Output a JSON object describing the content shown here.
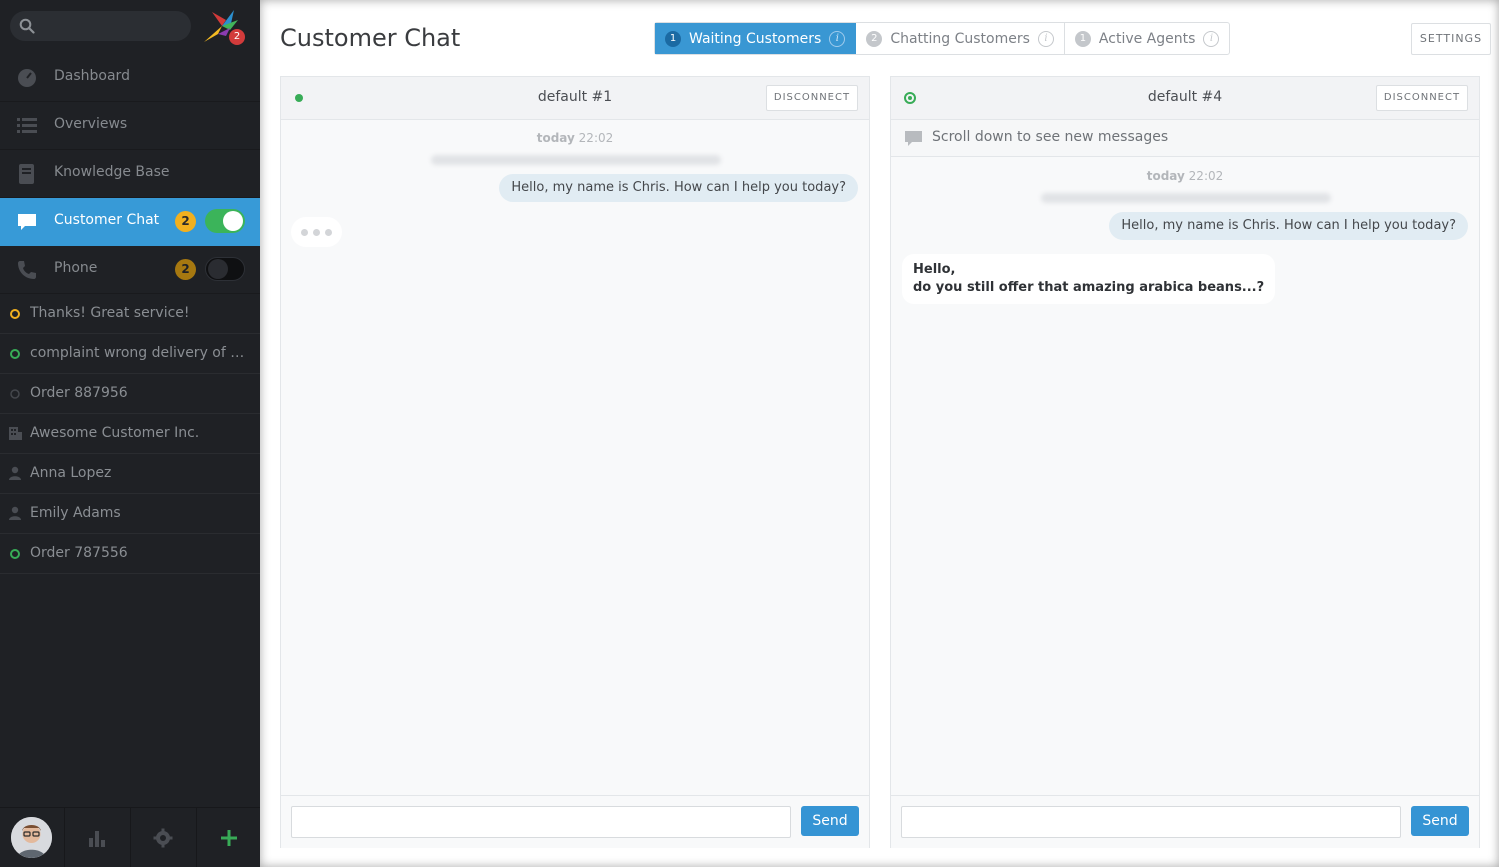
{
  "logo": {
    "badge": "2"
  },
  "nav": [
    {
      "label": "Dashboard"
    },
    {
      "label": "Overviews"
    },
    {
      "label": "Knowledge Base"
    },
    {
      "label": "Customer Chat",
      "count": "2"
    },
    {
      "label": "Phone",
      "count": "2"
    }
  ],
  "tasks": [
    {
      "label": "Thanks! Great service!"
    },
    {
      "label": "complaint wrong delivery of order"
    },
    {
      "label": "Order 887956"
    },
    {
      "label": "Awesome Customer Inc."
    },
    {
      "label": "Anna Lopez"
    },
    {
      "label": "Emily Adams"
    },
    {
      "label": "Order 787556"
    }
  ],
  "header": {
    "title": "Customer Chat",
    "tabs": [
      {
        "num": "1",
        "label": "Waiting Customers",
        "info": "i"
      },
      {
        "num": "2",
        "label": "Chatting Customers",
        "info": "i"
      },
      {
        "num": "1",
        "label": "Active Agents",
        "info": "i"
      }
    ],
    "settings": "SETTINGS"
  },
  "chats": [
    {
      "title": "default #1",
      "disconnect": "DISCONNECT",
      "time_day": "today",
      "time_clock": "22:02",
      "agent_message": "Hello, my name is Chris. How can I help you today?",
      "send": "Send",
      "input_value": ""
    },
    {
      "title": "default #4",
      "disconnect": "DISCONNECT",
      "scroll_note": "Scroll down to see new messages",
      "time_day": "today",
      "time_clock": "22:02",
      "agent_message": "Hello, my name is Chris. How can I help you today?",
      "customer_line1": "Hello,",
      "customer_line2": "do you still offer that amazing arabica beans...?",
      "send": "Send",
      "input_value": ""
    }
  ],
  "colors": {
    "accent": "#379ad7",
    "online": "#38ac57",
    "badge": "#f1b01f"
  }
}
